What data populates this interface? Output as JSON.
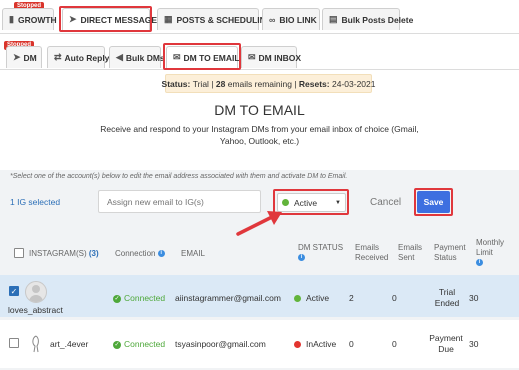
{
  "top_tabs": [
    {
      "label": "GROWTH",
      "icon": "bar-chart-icon",
      "badge": "Stopped"
    },
    {
      "label": "DIRECT MESSAGES",
      "icon": "send-icon"
    },
    {
      "label": "POSTS & SCHEDULING",
      "icon": "calendar-icon"
    },
    {
      "label": "BIO LINK",
      "icon": "link-icon"
    },
    {
      "label": "Bulk Posts Delete",
      "icon": "document-icon"
    }
  ],
  "sub_tabs": [
    {
      "label": "DM",
      "icon": "send-icon",
      "badge": "Stopped"
    },
    {
      "label": "Auto Reply",
      "icon": "reply-icon"
    },
    {
      "label": "Bulk DMs",
      "icon": "megaphone-icon"
    },
    {
      "label": "DM TO EMAIL",
      "icon": "email-doc-icon"
    },
    {
      "label": "DM INBOX",
      "icon": "envelope-icon"
    }
  ],
  "status": {
    "label": "Status:",
    "plan": "Trial",
    "count": "28",
    "count_text": "emails remaining",
    "resets_label": "Resets:",
    "resets_date": "24-03-2021"
  },
  "page": {
    "title": "DM TO EMAIL",
    "description": "Receive and respond to your Instagram DMs from your email inbox of choice (Gmail, Yahoo, Outlook, etc.)"
  },
  "hint": "*Select one of the account(s) below to edit the email address associated with them and activate DM to Email.",
  "controls": {
    "selected_count": "1 IG selected",
    "assign_placeholder": "Assign new email to IG(s)",
    "dropdown_value": "Active",
    "cancel_label": "Cancel",
    "save_label": "Save"
  },
  "table": {
    "headers": {
      "instagram": "INSTAGRAM(S)",
      "instagram_count": "(3)",
      "connection": "Connection",
      "email": "EMAIL",
      "dm_status": "DM STATUS",
      "emails_received": "Emails Received",
      "emails_sent": "Emails Sent",
      "payment_status": "Payment Status",
      "monthly_limit": "Monthly Limit"
    },
    "rows": [
      {
        "checked": true,
        "username": "loves_abstract",
        "connection": "Connected",
        "email": "aiinstagrammer@gmail.com",
        "dm_status": "Active",
        "emails_received": "2",
        "emails_sent": "0",
        "payment_status": "Trial Ended",
        "monthly_limit": "30"
      },
      {
        "checked": false,
        "username": "art_.4ever",
        "connection": "Connected",
        "email": "tsyasinpoor@gmail.com",
        "dm_status": "InActive",
        "emails_received": "0",
        "emails_sent": "0",
        "payment_status": "Payment Due",
        "monthly_limit": "30"
      }
    ]
  },
  "colors": {
    "highlight": "#e0373c",
    "save_button": "#3d6fe0",
    "selected_row": "#dbe9f6",
    "active_dot": "#62b43b",
    "inactive_dot": "#e3342f",
    "status_bg": "#fcefd9"
  }
}
